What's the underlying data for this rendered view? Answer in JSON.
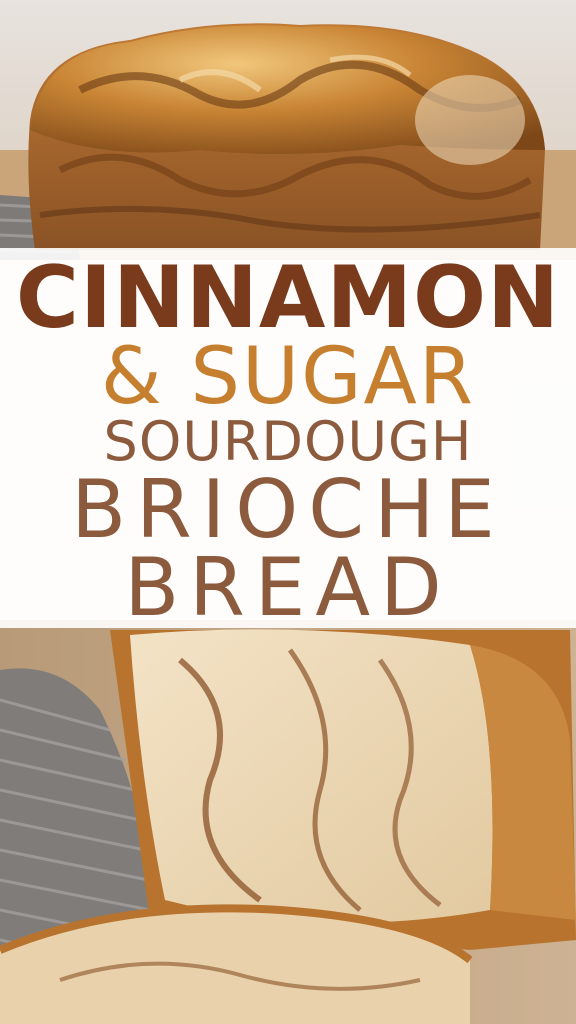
{
  "title": {
    "line1": "CINNAMON",
    "line2": "& SUGAR",
    "line3": "SOURDOUGH",
    "line4": "BRIOCHE",
    "line5": "BREAD"
  },
  "colors": {
    "title_dark_brown": "#7a3a1c",
    "title_caramel": "#c57f2e",
    "title_mid_brown": "#8c5a3c",
    "crust": "#b8742f",
    "crumb": "#ecd6b2"
  }
}
